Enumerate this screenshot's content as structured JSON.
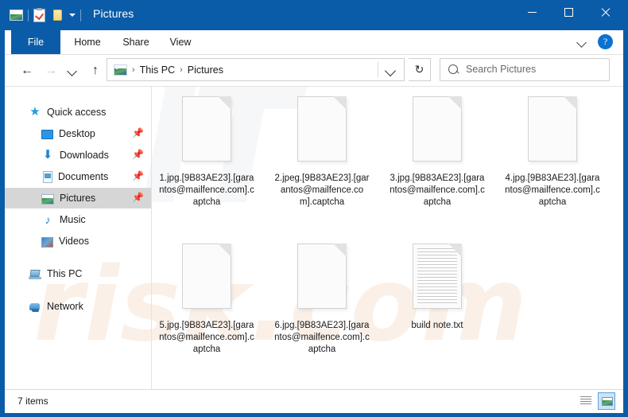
{
  "window": {
    "title": "Pictures",
    "accent_color": "#0b5ca8",
    "quick_access_toolbar": [
      {
        "name": "pictures-icon",
        "label": "Pictures"
      },
      {
        "name": "properties-icon",
        "label": "Properties"
      },
      {
        "name": "new-folder-icon",
        "label": "New folder"
      },
      {
        "name": "customize-dropdown",
        "label": "Customize Quick Access Toolbar"
      }
    ],
    "controls": {
      "minimize": "–",
      "maximize": "□",
      "close": "✕"
    }
  },
  "ribbon": {
    "tabs": [
      {
        "label": "File",
        "selected": true
      },
      {
        "label": "Home",
        "selected": false
      },
      {
        "label": "Share",
        "selected": false
      },
      {
        "label": "View",
        "selected": false
      }
    ],
    "collapse_label": "Minimize the Ribbon",
    "help_label": "?"
  },
  "navbar": {
    "back": "←",
    "forward": "→",
    "recent": "",
    "up": "↑",
    "breadcrumb": [
      "This PC",
      "Pictures"
    ],
    "separator": "›",
    "refresh": "↻",
    "search": {
      "placeholder": "Search Pictures",
      "value": ""
    }
  },
  "sidebar": {
    "items": [
      {
        "label": "Quick access",
        "icon": "star-icon",
        "indent": 0,
        "pinned": false,
        "selected": false
      },
      {
        "label": "Desktop",
        "icon": "desktop-icon",
        "indent": 1,
        "pinned": true,
        "selected": false
      },
      {
        "label": "Downloads",
        "icon": "download-icon",
        "indent": 1,
        "pinned": true,
        "selected": false
      },
      {
        "label": "Documents",
        "icon": "document-icon",
        "indent": 1,
        "pinned": true,
        "selected": false
      },
      {
        "label": "Pictures",
        "icon": "pictures-icon",
        "indent": 1,
        "pinned": true,
        "selected": true
      },
      {
        "label": "Music",
        "icon": "music-icon",
        "indent": 1,
        "pinned": false,
        "selected": false
      },
      {
        "label": "Videos",
        "icon": "video-icon",
        "indent": 1,
        "pinned": false,
        "selected": false
      },
      {
        "label": "This PC",
        "icon": "pc-icon",
        "indent": 0,
        "pinned": false,
        "selected": false
      },
      {
        "label": "Network",
        "icon": "network-icon",
        "indent": 0,
        "pinned": false,
        "selected": false
      }
    ],
    "pin_glyph": "📌"
  },
  "files": [
    {
      "name": "1.jpg.[9B83AE23].[garantos@mailfence.com].captcha",
      "icon": "blank-page-icon"
    },
    {
      "name": "2.jpeg.[9B83AE23].[garantos@mailfence.com].captcha",
      "icon": "blank-page-icon"
    },
    {
      "name": "3.jpg.[9B83AE23].[garantos@mailfence.com].captcha",
      "icon": "blank-page-icon"
    },
    {
      "name": "4.jpg.[9B83AE23].[garantos@mailfence.com].captcha",
      "icon": "blank-page-icon"
    },
    {
      "name": "5.jpg.[9B83AE23].[garantos@mailfence.com].captcha",
      "icon": "blank-page-icon"
    },
    {
      "name": "6.jpg.[9B83AE23].[garantos@mailfence.com].captcha",
      "icon": "blank-page-icon"
    },
    {
      "name": "build note.txt",
      "icon": "text-page-icon"
    }
  ],
  "statusbar": {
    "item_count": "7 items",
    "views": [
      {
        "name": "details-view",
        "active": false
      },
      {
        "name": "large-icons-view",
        "active": true
      }
    ]
  },
  "watermark": {
    "upper": "IT",
    "lower": "risk.com"
  }
}
